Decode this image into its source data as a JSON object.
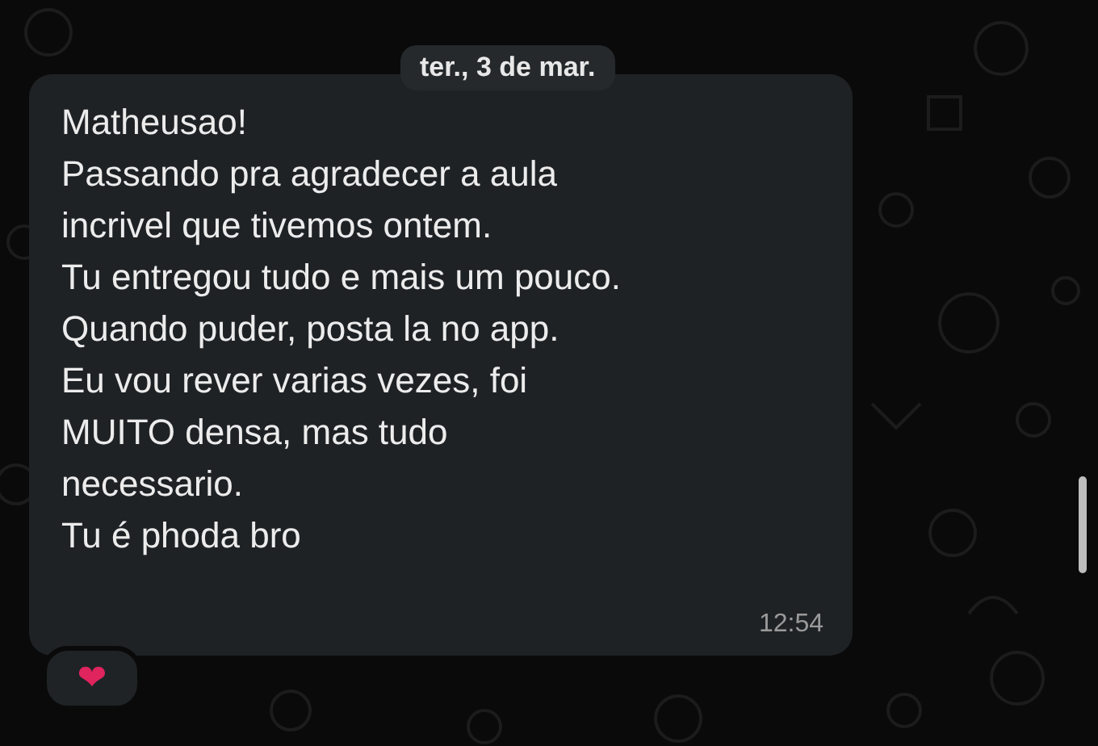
{
  "date_chip": "ter., 3 de mar.",
  "message": {
    "text": "Matheusao!\nPassando pra agradecer a aula\nincrivel que tivemos ontem.\nTu entregou tudo e mais um pouco.\nQuando puder, posta la no app.\nEu vou rever varias vezes, foi\nMUITO densa, mas tudo\nnecessario.\nTu é phoda bro",
    "time": "12:54",
    "reaction": "❤"
  }
}
